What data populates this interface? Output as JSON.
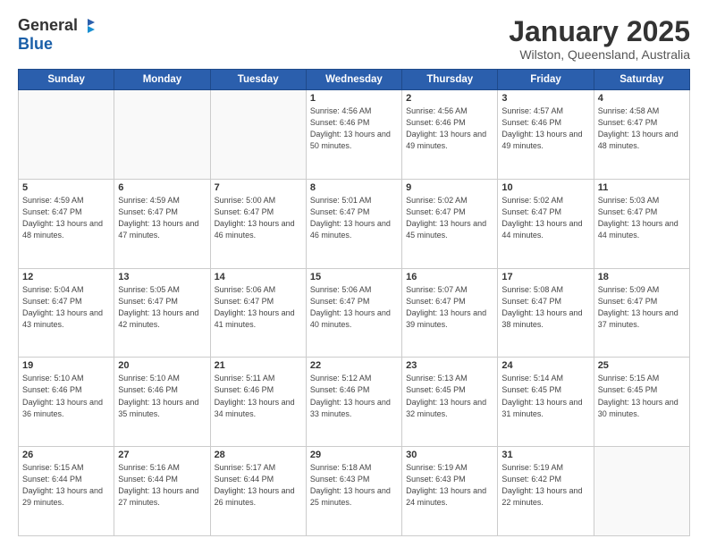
{
  "logo": {
    "general": "General",
    "blue": "Blue"
  },
  "header": {
    "month": "January 2025",
    "location": "Wilston, Queensland, Australia"
  },
  "weekdays": [
    "Sunday",
    "Monday",
    "Tuesday",
    "Wednesday",
    "Thursday",
    "Friday",
    "Saturday"
  ],
  "weeks": [
    [
      {
        "day": "",
        "info": ""
      },
      {
        "day": "",
        "info": ""
      },
      {
        "day": "",
        "info": ""
      },
      {
        "day": "1",
        "info": "Sunrise: 4:56 AM\nSunset: 6:46 PM\nDaylight: 13 hours\nand 50 minutes."
      },
      {
        "day": "2",
        "info": "Sunrise: 4:56 AM\nSunset: 6:46 PM\nDaylight: 13 hours\nand 49 minutes."
      },
      {
        "day": "3",
        "info": "Sunrise: 4:57 AM\nSunset: 6:46 PM\nDaylight: 13 hours\nand 49 minutes."
      },
      {
        "day": "4",
        "info": "Sunrise: 4:58 AM\nSunset: 6:47 PM\nDaylight: 13 hours\nand 48 minutes."
      }
    ],
    [
      {
        "day": "5",
        "info": "Sunrise: 4:59 AM\nSunset: 6:47 PM\nDaylight: 13 hours\nand 48 minutes."
      },
      {
        "day": "6",
        "info": "Sunrise: 4:59 AM\nSunset: 6:47 PM\nDaylight: 13 hours\nand 47 minutes."
      },
      {
        "day": "7",
        "info": "Sunrise: 5:00 AM\nSunset: 6:47 PM\nDaylight: 13 hours\nand 46 minutes."
      },
      {
        "day": "8",
        "info": "Sunrise: 5:01 AM\nSunset: 6:47 PM\nDaylight: 13 hours\nand 46 minutes."
      },
      {
        "day": "9",
        "info": "Sunrise: 5:02 AM\nSunset: 6:47 PM\nDaylight: 13 hours\nand 45 minutes."
      },
      {
        "day": "10",
        "info": "Sunrise: 5:02 AM\nSunset: 6:47 PM\nDaylight: 13 hours\nand 44 minutes."
      },
      {
        "day": "11",
        "info": "Sunrise: 5:03 AM\nSunset: 6:47 PM\nDaylight: 13 hours\nand 44 minutes."
      }
    ],
    [
      {
        "day": "12",
        "info": "Sunrise: 5:04 AM\nSunset: 6:47 PM\nDaylight: 13 hours\nand 43 minutes."
      },
      {
        "day": "13",
        "info": "Sunrise: 5:05 AM\nSunset: 6:47 PM\nDaylight: 13 hours\nand 42 minutes."
      },
      {
        "day": "14",
        "info": "Sunrise: 5:06 AM\nSunset: 6:47 PM\nDaylight: 13 hours\nand 41 minutes."
      },
      {
        "day": "15",
        "info": "Sunrise: 5:06 AM\nSunset: 6:47 PM\nDaylight: 13 hours\nand 40 minutes."
      },
      {
        "day": "16",
        "info": "Sunrise: 5:07 AM\nSunset: 6:47 PM\nDaylight: 13 hours\nand 39 minutes."
      },
      {
        "day": "17",
        "info": "Sunrise: 5:08 AM\nSunset: 6:47 PM\nDaylight: 13 hours\nand 38 minutes."
      },
      {
        "day": "18",
        "info": "Sunrise: 5:09 AM\nSunset: 6:47 PM\nDaylight: 13 hours\nand 37 minutes."
      }
    ],
    [
      {
        "day": "19",
        "info": "Sunrise: 5:10 AM\nSunset: 6:46 PM\nDaylight: 13 hours\nand 36 minutes."
      },
      {
        "day": "20",
        "info": "Sunrise: 5:10 AM\nSunset: 6:46 PM\nDaylight: 13 hours\nand 35 minutes."
      },
      {
        "day": "21",
        "info": "Sunrise: 5:11 AM\nSunset: 6:46 PM\nDaylight: 13 hours\nand 34 minutes."
      },
      {
        "day": "22",
        "info": "Sunrise: 5:12 AM\nSunset: 6:46 PM\nDaylight: 13 hours\nand 33 minutes."
      },
      {
        "day": "23",
        "info": "Sunrise: 5:13 AM\nSunset: 6:45 PM\nDaylight: 13 hours\nand 32 minutes."
      },
      {
        "day": "24",
        "info": "Sunrise: 5:14 AM\nSunset: 6:45 PM\nDaylight: 13 hours\nand 31 minutes."
      },
      {
        "day": "25",
        "info": "Sunrise: 5:15 AM\nSunset: 6:45 PM\nDaylight: 13 hours\nand 30 minutes."
      }
    ],
    [
      {
        "day": "26",
        "info": "Sunrise: 5:15 AM\nSunset: 6:44 PM\nDaylight: 13 hours\nand 29 minutes."
      },
      {
        "day": "27",
        "info": "Sunrise: 5:16 AM\nSunset: 6:44 PM\nDaylight: 13 hours\nand 27 minutes."
      },
      {
        "day": "28",
        "info": "Sunrise: 5:17 AM\nSunset: 6:44 PM\nDaylight: 13 hours\nand 26 minutes."
      },
      {
        "day": "29",
        "info": "Sunrise: 5:18 AM\nSunset: 6:43 PM\nDaylight: 13 hours\nand 25 minutes."
      },
      {
        "day": "30",
        "info": "Sunrise: 5:19 AM\nSunset: 6:43 PM\nDaylight: 13 hours\nand 24 minutes."
      },
      {
        "day": "31",
        "info": "Sunrise: 5:19 AM\nSunset: 6:42 PM\nDaylight: 13 hours\nand 22 minutes."
      },
      {
        "day": "",
        "info": ""
      }
    ]
  ]
}
